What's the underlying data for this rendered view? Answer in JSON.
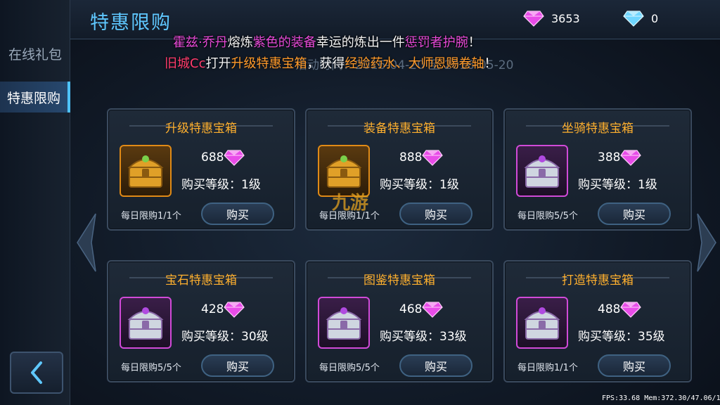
{
  "header": {
    "title": "特惠限购",
    "currency": [
      {
        "type": "purple-gem-icon",
        "amount": "3653"
      },
      {
        "type": "blue-gem-icon",
        "amount": "0"
      }
    ]
  },
  "sidebar": {
    "tabs": [
      {
        "label": "在线礼包",
        "active": false
      },
      {
        "label": "特惠限购",
        "active": true
      }
    ]
  },
  "broadcast": {
    "line1": {
      "player": "霍兹·乔丹",
      "verb": "熔炼",
      "item": "紫色的装备",
      "mid": "幸运的炼出一件",
      "reward": "惩罚者护腕",
      "end": "！"
    },
    "line2": {
      "player": "旧城Cc",
      "verb": "打开",
      "item": "升级特惠宝箱",
      "mid": "，获得",
      "reward": "经验药水、大师恩赐卷轴",
      "end": "！"
    },
    "event_time": "活动时间：2016-04-20 至 2016-05-20"
  },
  "cards": [
    {
      "title": "升级特惠宝箱",
      "price": "688",
      "level_label": "购买等级：1级",
      "limit": "每日限购1/1个",
      "buy": "购买",
      "chest": "gold"
    },
    {
      "title": "装备特惠宝箱",
      "price": "888",
      "level_label": "购买等级：1级",
      "limit": "每日限购1/1个",
      "buy": "购买",
      "chest": "gold"
    },
    {
      "title": "坐骑特惠宝箱",
      "price": "388",
      "level_label": "购买等级：1级",
      "limit": "每日限购5/5个",
      "buy": "购买",
      "chest": "purple"
    },
    {
      "title": "宝石特惠宝箱",
      "price": "428",
      "level_label": "购买等级：30级",
      "limit": "每日限购5/5个",
      "buy": "购买",
      "chest": "purple"
    },
    {
      "title": "图鉴特惠宝箱",
      "price": "468",
      "level_label": "购买等级：33级",
      "limit": "每日限购5/5个",
      "buy": "购买",
      "chest": "purple"
    },
    {
      "title": "打造特惠宝箱",
      "price": "488",
      "level_label": "购买等级：35级",
      "limit": "每日限购1/1个",
      "buy": "购买",
      "chest": "purple"
    }
  ],
  "watermark": "九游",
  "status": {
    "fps": "FPS:33.68",
    "mem": "Mem:372.30/47.06/10.57"
  },
  "colors": {
    "accent": "#5fc8ff",
    "title_orange": "#ffb02e",
    "gem_purple": "#e84ce8",
    "gem_blue": "#6fd6ff"
  }
}
